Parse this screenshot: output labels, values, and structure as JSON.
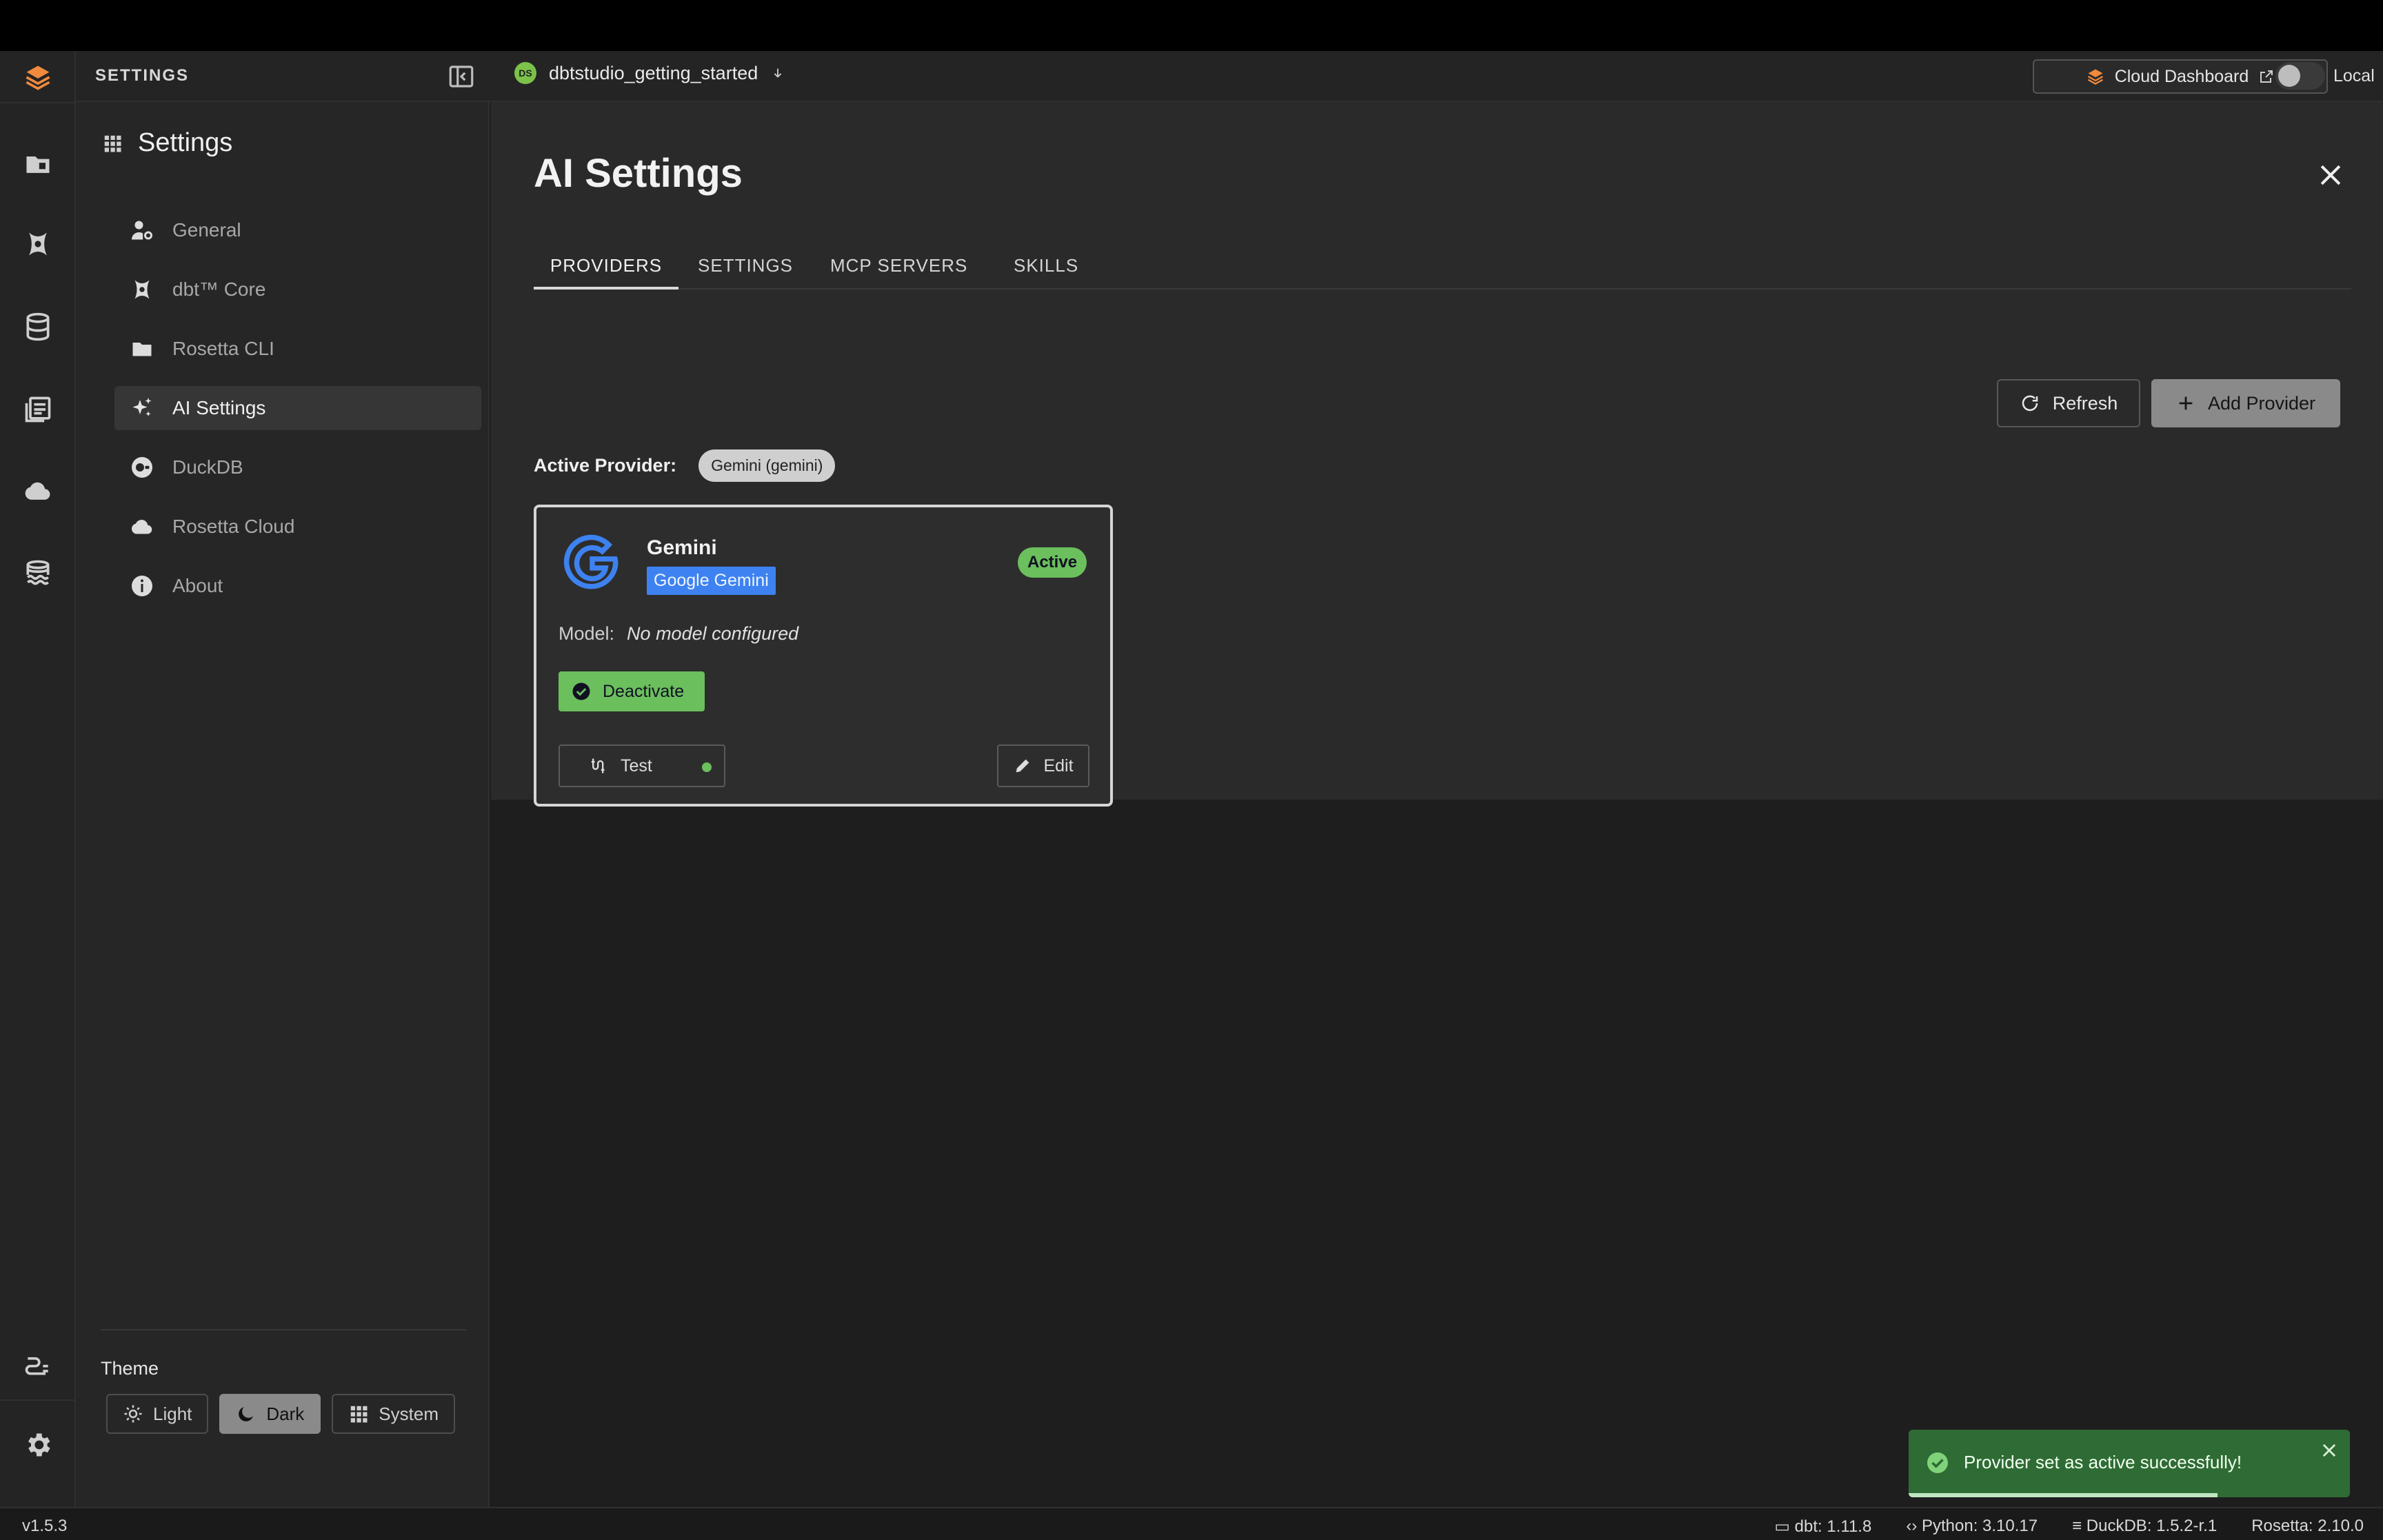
{
  "header": {
    "section_label": "SETTINGS",
    "project_name": "dbtstudio_getting_started",
    "project_avatar": "DS",
    "cloud_dashboard_label": "Cloud Dashboard",
    "mode_label": "Local"
  },
  "nav": {
    "title": "Settings",
    "items": [
      {
        "label": "General",
        "icon": "user-gear-icon"
      },
      {
        "label": "dbt™ Core",
        "icon": "dbt-icon"
      },
      {
        "label": "Rosetta CLI",
        "icon": "folder-icon"
      },
      {
        "label": "AI Settings",
        "icon": "sparkles-icon"
      },
      {
        "label": "DuckDB",
        "icon": "duckdb-icon"
      },
      {
        "label": "Rosetta Cloud",
        "icon": "cloud-icon"
      },
      {
        "label": "About",
        "icon": "info-icon"
      }
    ],
    "active_item": "AI Settings",
    "theme_label": "Theme",
    "theme_options": [
      "Light",
      "Dark",
      "System"
    ],
    "theme_selected": "Dark"
  },
  "main": {
    "title": "AI Settings",
    "tabs": [
      "PROVIDERS",
      "SETTINGS",
      "MCP SERVERS",
      "SKILLS"
    ],
    "active_tab": "PROVIDERS",
    "refresh_label": "Refresh",
    "add_provider_label": "Add Provider",
    "active_provider_label": "Active Provider:",
    "active_provider_value": "Gemini (gemini)"
  },
  "card": {
    "name": "Gemini",
    "tag": "Google Gemini",
    "status": "Active",
    "model_label": "Model:",
    "model_value": "No model configured",
    "deactivate_label": "Deactivate",
    "test_label": "Test",
    "edit_label": "Edit"
  },
  "toast": {
    "message": "Provider set as active successfully!",
    "progress": 0.7
  },
  "statusbar": {
    "version": "v1.5.3",
    "dbt": "dbt: 1.11.8",
    "python": "Python: 3.10.17",
    "duckdb": "DuckDB: 1.5.2-r.1",
    "rosetta": "Rosetta: 2.10.0"
  },
  "colors": {
    "accent_green": "#6bbf5d",
    "gemini_blue": "#3d82f0",
    "brand_orange": "#f08a3c"
  }
}
